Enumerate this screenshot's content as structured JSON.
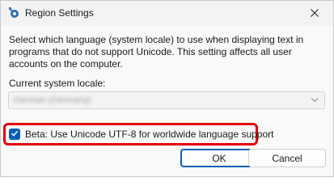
{
  "window": {
    "title": "Region Settings",
    "icon": "region-settings-icon",
    "close_icon": "close-icon"
  },
  "content": {
    "description": "Select which language (system locale) to use when displaying text in programs that do not support Unicode. This setting affects all user accounts on the computer.",
    "locale_label": "Current system locale:",
    "locale_value": "German (Germany)",
    "locale_value_blurred": true,
    "checkbox_label": "Beta: Use Unicode UTF-8 for worldwide language support",
    "checkbox_checked": true,
    "highlight_color": "#e3000f",
    "accent_color": "#0a5fb4"
  },
  "buttons": {
    "ok": "OK",
    "cancel": "Cancel"
  }
}
